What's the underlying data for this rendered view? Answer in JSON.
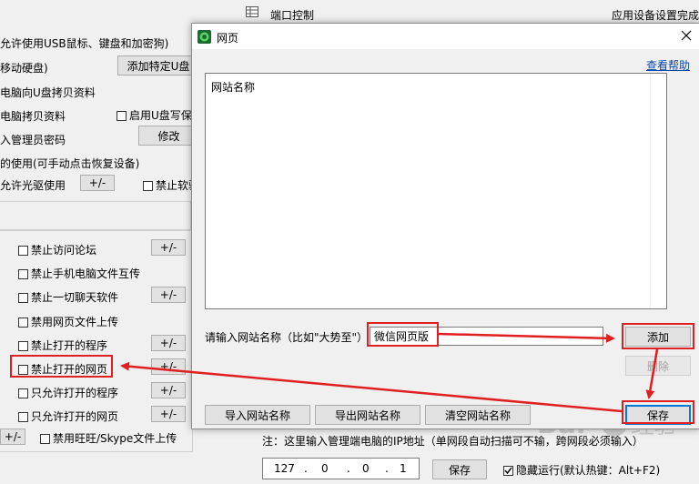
{
  "background": {
    "top_left_item": "端口控制",
    "top_right_status": "应用设备设置完成",
    "usb_allow": "允许使用USB鼠标、键盘和加密狗)",
    "mobile_disk": "移动硬盘)",
    "add_usb_button": "添加特定U盘",
    "pc_to_usb": "电脑向U盘拷贝资料",
    "copy_from_pc": "电脑拷贝资料",
    "enable_usb_write": "启用U盘写保",
    "admin_password": "入管理员密码",
    "modify_button": "修改",
    "manual_restore": "的使用(可手动点击恢复设备)",
    "allow_optical": "允许光驱使用",
    "plusminus": "+/-",
    "forbid_soft": "禁止软驱",
    "items": [
      {
        "label": "禁止访问论坛",
        "has_button": true
      },
      {
        "label": "禁止手机电脑文件互传",
        "has_button": false
      },
      {
        "label": "禁止一切聊天软件",
        "has_button": true
      },
      {
        "label": "禁用网页文件上传",
        "has_button": false
      },
      {
        "label": "禁止打开的程序",
        "has_button": true
      },
      {
        "label": "禁止打开的网页",
        "has_button": true
      },
      {
        "label": "只允许打开的程序",
        "has_button": true
      },
      {
        "label": "只允许打开的网页",
        "has_button": true
      }
    ],
    "wangwang": "禁用旺旺/Skype文件上传",
    "note": "注：这里输入管理端电脑的IP地址（单网段自动扫描可不输，跨网段必须输入）",
    "ip": [
      "127",
      "0",
      "0",
      "1"
    ],
    "save_button": "保存",
    "hide_run": "隐藏运行(默认热键：Alt+F2)"
  },
  "dialog": {
    "title": "网页",
    "help_link": "查看帮助",
    "list_header": "网站名称",
    "input_label": "请输入网站名称（比如\"大势至\"）",
    "input_value": "微信网页版",
    "add_button": "添加",
    "delete_button": "删除",
    "import_button": "导入网站名称",
    "export_button": "导出网站名称",
    "clear_button": "清空网站名称",
    "save_button": "保存"
  },
  "colors": {
    "annotation_red": "#e02020",
    "link_blue": "#0645ad",
    "focus_blue": "#0078d7"
  }
}
